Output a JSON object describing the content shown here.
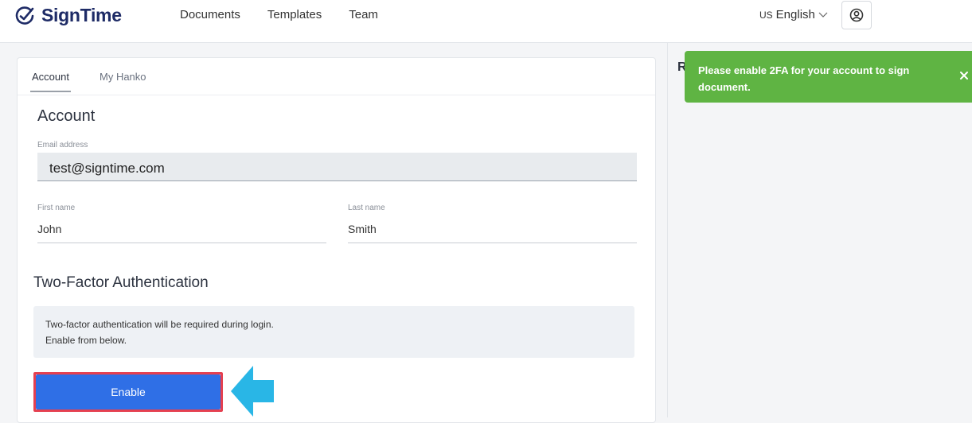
{
  "app": {
    "name": "SignTime"
  },
  "nav": {
    "documents": "Documents",
    "templates": "Templates",
    "team": "Team"
  },
  "lang": {
    "flag": "US",
    "label": "English"
  },
  "tabs": {
    "account": "Account",
    "hanko": "My Hanko"
  },
  "account": {
    "title": "Account",
    "email_label": "Email address",
    "email_value": "test@signtime.com",
    "first_label": "First name",
    "first_value": "John",
    "last_label": "Last name",
    "last_value": "Smith"
  },
  "tfa": {
    "title": "Two-Factor Authentication",
    "line1": "Two-factor authentication will be required during login.",
    "line2": "Enable from below.",
    "button": "Enable"
  },
  "right": {
    "partial_heading": "R"
  },
  "toast": {
    "message": "Please enable 2FA for your account to sign document."
  },
  "colors": {
    "brand": "#1e2b66",
    "primary_button": "#2f6fe6",
    "highlight": "#e54050",
    "toast": "#5fb443",
    "arrow": "#29b6e6"
  },
  "icons": {
    "logo": "pen-check-icon",
    "user": "user-circle-icon",
    "close": "close-icon",
    "arrow": "arrow-right-icon"
  }
}
